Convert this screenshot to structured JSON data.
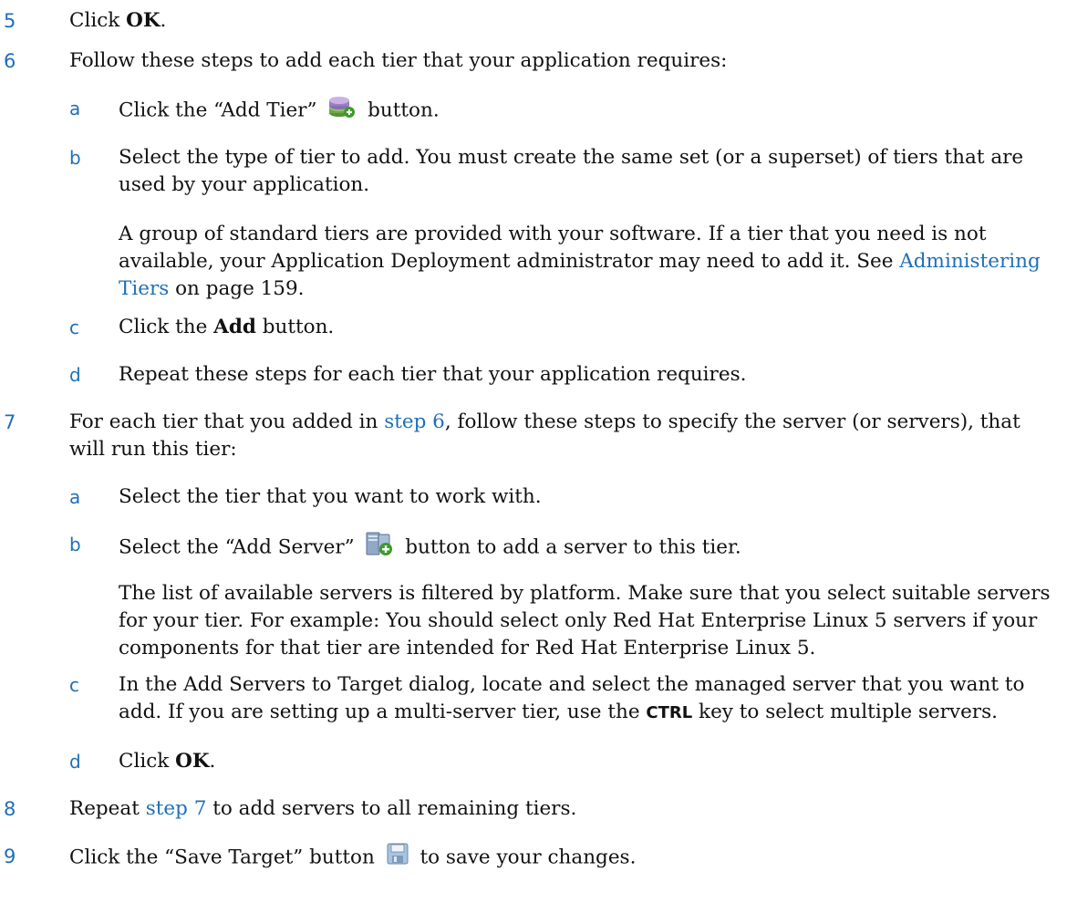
{
  "steps": {
    "s5": {
      "num": "5",
      "pre": "Click ",
      "bold": "OK",
      "post": "."
    },
    "s6": {
      "num": "6",
      "text": "Follow these steps to add each tier that your application requires:",
      "a": {
        "letter": "a",
        "pre": "Click the “Add Tier”",
        "post": "button."
      },
      "b": {
        "letter": "b",
        "text": "Select the type of tier to add. You must create the same set (or a superset) of tiers that are used by your application."
      },
      "b_para": {
        "text": "A group of standard tiers are provided with your software. If a tier that you need is not available, your Application Deployment administrator may need to add it. See ",
        "link": "Administering Tiers",
        "post": " on page 159."
      },
      "c": {
        "letter": "c",
        "pre": "Click the ",
        "bold": "Add",
        "post": " button."
      },
      "d": {
        "letter": "d",
        "text": "Repeat these steps for each tier that your application requires."
      }
    },
    "s7": {
      "num": "7",
      "pre": "For each tier that you added in ",
      "link": "step 6",
      "post": ", follow these steps to specify the server (or servers), that will run this tier:",
      "a": {
        "letter": "a",
        "text": "Select the tier that you want to work with."
      },
      "b": {
        "letter": "b",
        "pre": "Select the “Add Server”",
        "post": "button to add a server to this tier."
      },
      "b_para": {
        "text": "The list of available servers is filtered by platform. Make sure that you select suitable servers for your tier. For example: You should select only Red Hat Enterprise Linux 5 servers if your components for that tier are intended for Red Hat Enterprise Linux 5."
      },
      "c": {
        "letter": "c",
        "pre": "In the Add Servers to Target dialog, locate and select the managed server that you want to add. If you are setting up a multi-server tier, use the ",
        "key": "CTRL",
        "post": " key to select multiple servers."
      },
      "d": {
        "letter": "d",
        "pre": "Click ",
        "bold": "OK",
        "post": "."
      }
    },
    "s8": {
      "num": "8",
      "pre": "Repeat ",
      "link": "step 7",
      "post": " to add servers to all remaining tiers."
    },
    "s9": {
      "num": "9",
      "pre": "Click the “Save Target” button",
      "post": "to save your changes."
    }
  },
  "icons": {
    "add_tier": "add-tier-icon",
    "add_server": "add-server-icon",
    "save_target": "save-target-icon"
  },
  "colors": {
    "accent": "#1f6fb8",
    "text": "#111111"
  }
}
